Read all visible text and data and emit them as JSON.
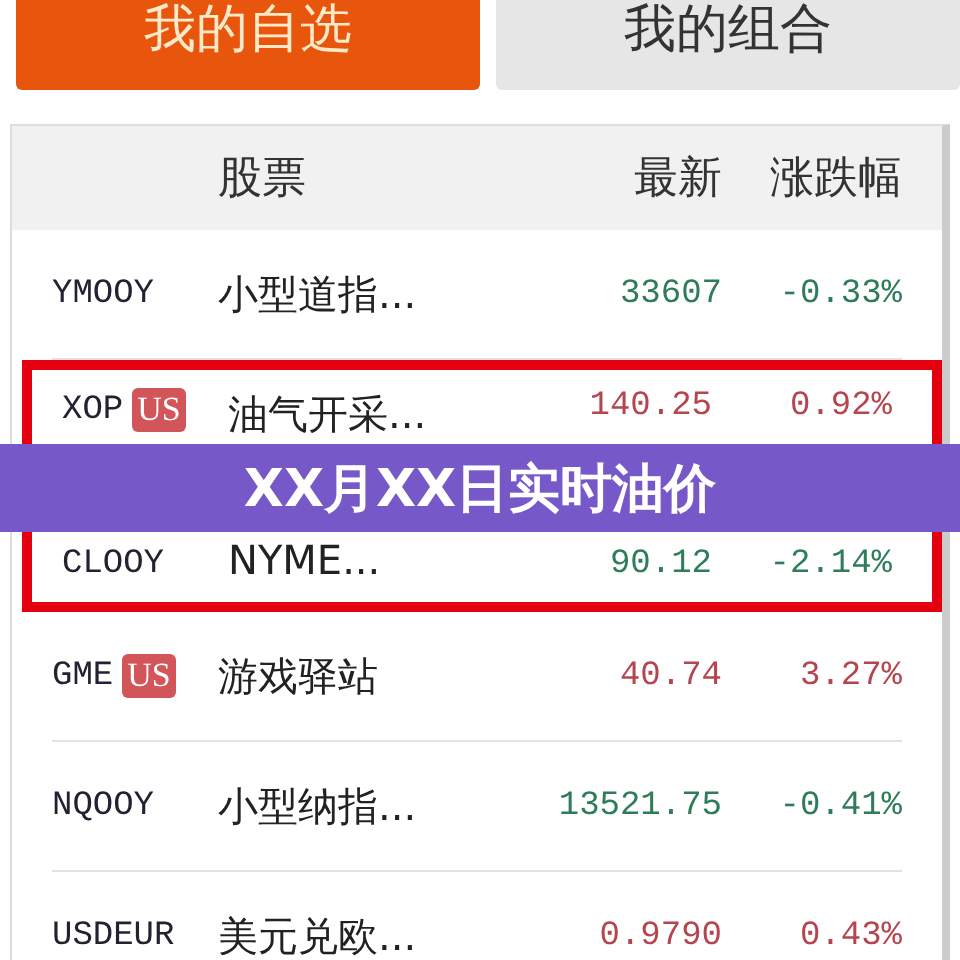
{
  "tabs": [
    {
      "label": "我的自选",
      "selected": true
    },
    {
      "label": "我的组合",
      "selected": false
    }
  ],
  "table": {
    "columns": [
      "股票",
      "最新",
      "涨跌幅"
    ],
    "rows": [
      {
        "code": "YMOOY",
        "name": "小型道指...",
        "price": "33607",
        "change": "-0.33%",
        "color": "#2f7d58",
        "highlighted": false
      },
      {
        "code": "XOP",
        "badge": "US",
        "name": "油气开采...",
        "price": "140.25",
        "change": "0.92%",
        "color": "#b5464f",
        "highlighted": true
      },
      {
        "code": "CLOOY",
        "name": "NYME...",
        "price": "90.12",
        "change": "-2.14%",
        "color": "#2f7d58",
        "highlighted": true
      },
      {
        "code": "GME",
        "badge": "US",
        "name": "游戏驿站",
        "price": "40.74",
        "change": "3.27%",
        "color": "#b5464f",
        "highlighted": false
      },
      {
        "code": "NQOOY",
        "name": "小型纳指...",
        "price": "13521.75",
        "change": "-0.41%",
        "color": "#2f7d58",
        "highlighted": false
      },
      {
        "code": "USDEUR",
        "name": "美元兑欧...",
        "price": "0.9790",
        "change": "0.43%",
        "color": "#b5464f",
        "highlighted": false
      }
    ]
  },
  "banner": {
    "title": "XX月XX日实时油价"
  }
}
